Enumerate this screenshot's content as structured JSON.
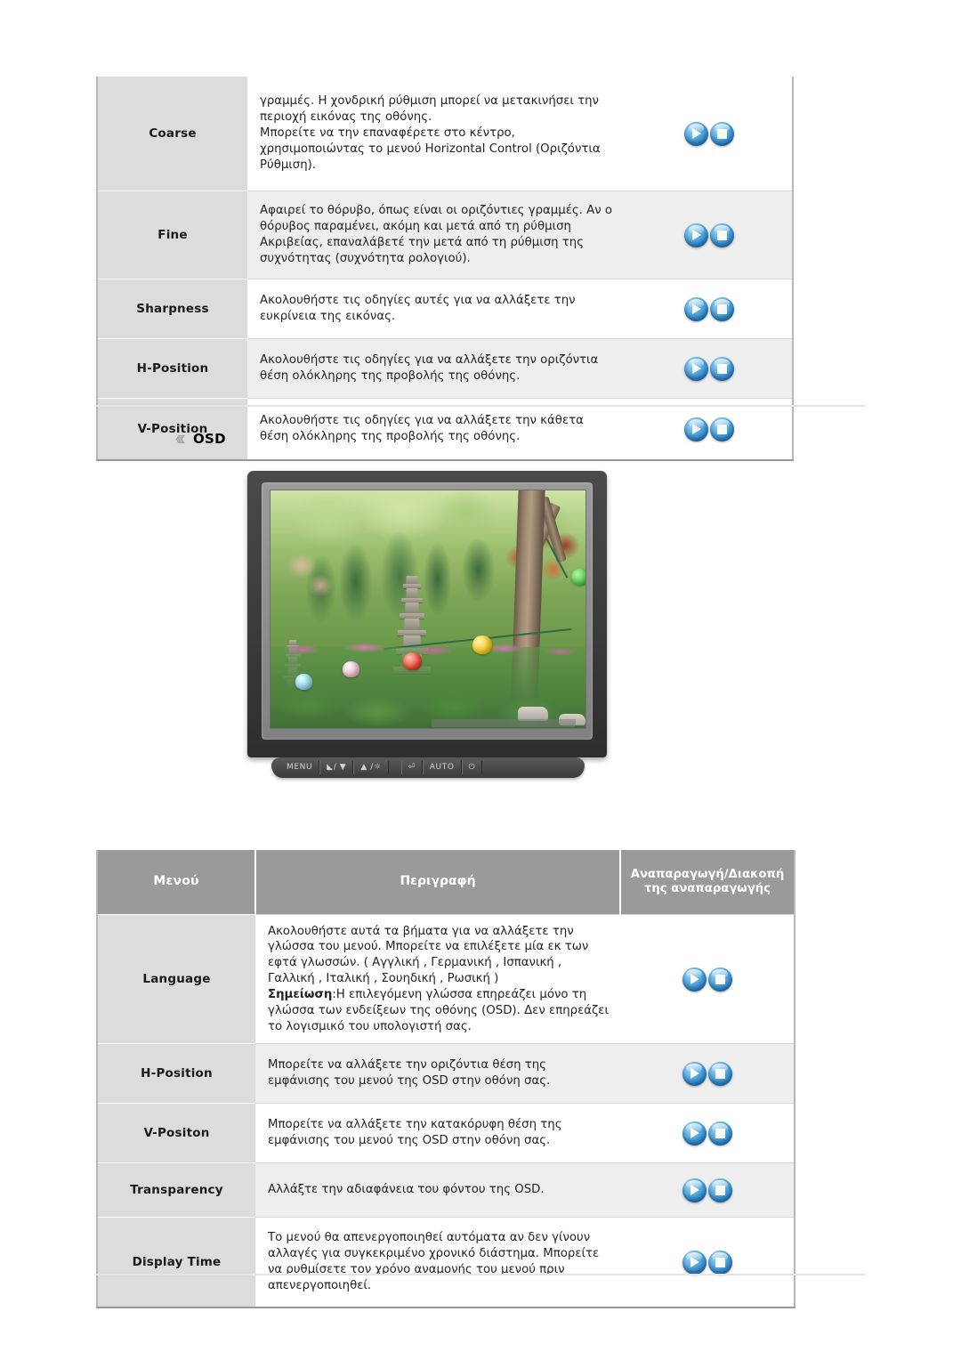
{
  "image_table": {
    "rows": [
      {
        "menu": "Coarse",
        "description": "γραμμές. Η χονδρική ρύθμιση μπορεί να μετακινήσει την περιοχή εικόνας της οθόνης.\nΜπορείτε να την επαναφέρετε στο κέντρο,\nχρησιμοποιώντας το μενού Horizontal Control (Οριζόντια Ρύθμιση).",
        "icons": [
          "play-button",
          "stop-button"
        ]
      },
      {
        "menu": "Fine",
        "description": "Αφαιρεί το θόρυβο, όπως είναι οι οριζόντιες γραμμές. Αν ο θόρυβος παραμένει, ακόμη και μετά από τη ρύθμιση Ακριβείας, επαναλάβετέ την μετά από τη ρύθμιση της συχνότητας (συχνότητα ρολογιού).",
        "icons": [
          "play-button",
          "stop-button"
        ]
      },
      {
        "menu": "Sharpness",
        "description": "Ακολουθήστε τις οδηγίες αυτές για να αλλάξετε την ευκρίνεια της εικόνας.",
        "icons": [
          "play-button",
          "stop-button"
        ]
      },
      {
        "menu": "H-Position",
        "description": "Ακολουθήστε τις οδηγίες για να αλλάξετε την οριζόντια θέση ολόκληρης της προβολής της οθόνης.",
        "icons": [
          "play-button",
          "stop-button"
        ]
      },
      {
        "menu": "V-Position",
        "description": "Ακολουθήστε τις οδηγίες για να αλλάξετε την κάθετα θέση ολόκληρης της προβολής της οθόνης.",
        "icons": [
          "play-button",
          "stop-button"
        ]
      }
    ]
  },
  "osd_section": {
    "bullet_icon": "arrow-bullet-icon",
    "heading": "OSD"
  },
  "monitor": {
    "screen_image_alt": "garden-with-stone-pagoda-and-paper-lanterns",
    "controls": [
      {
        "label": "MENU",
        "icon": "menu-button"
      },
      {
        "label": "/ ▼",
        "icon": "contrast-down-button"
      },
      {
        "label": "▲ /",
        "icon": "brightness-up-button"
      },
      {
        "label": "",
        "icon": "enter-source-button"
      },
      {
        "label": "AUTO",
        "icon": "auto-button"
      },
      {
        "label": "",
        "icon": "power-button"
      }
    ]
  },
  "osd_table": {
    "headers": {
      "menu": "Μενού",
      "description": "Περιγραφή",
      "playback": "Αναπαραγωγή/Διακοπή της αναπαραγωγής"
    },
    "rows": [
      {
        "menu": "Language",
        "description": "Ακολουθήστε αυτά τα βήματα για να αλλάξετε την γλώσσα του μενού. Μπορείτε να επιλέξετε μία εκ των εφτά γλωσσών. ( Αγγλική , Γερμανική , Ισπανική , Γαλλική , Ιταλική , Σουηδική , Ρωσική )",
        "note_label": "Σημείωση",
        "note_text": ":Η επιλεγόμενη γλώσσα επηρεάζει μόνο τη γλώσσα των ενδείξεων της οθόνης (OSD). Δεν επηρεάζει το λογισμικό του υπολογιστή σας.",
        "icons": [
          "play-button",
          "stop-button"
        ]
      },
      {
        "menu": "H-Position",
        "description": "Μπορείτε να αλλάξετε την οριζόντια θέση της εμφάνισης του μενού της OSD στην οθόνη σας.",
        "icons": [
          "play-button",
          "stop-button"
        ]
      },
      {
        "menu": "V-Positon",
        "description": "Μπορείτε να αλλάξετε την κατακόρυφη θέση της εμφάνισης του μενού της OSD στην οθόνη σας.",
        "icons": [
          "play-button",
          "stop-button"
        ]
      },
      {
        "menu": "Transparency",
        "description": "Αλλάξτε την αδιαφάνεια του φόντου της OSD.",
        "icons": [
          "play-button",
          "stop-button"
        ]
      },
      {
        "menu": "Display Time",
        "description": "Το μενού θα απενεργοποιηθεί αυτόματα αν δεν γίνουν αλλαγές για συγκεκριμένο χρονικό διάστημα. Μπορείτε να ρυθμίσετε τον χρόνο αναμονής του μενού πριν απενεργοποιηθεί.",
        "icons": [
          "play-button",
          "stop-button"
        ]
      }
    ]
  },
  "colors": {
    "header_band": "#9a9a9a",
    "menu_cell": "#dcdcdc",
    "row_shade": "#eeeeee",
    "button_blue": "#2e86c8",
    "rule": "#e4e4e4"
  }
}
